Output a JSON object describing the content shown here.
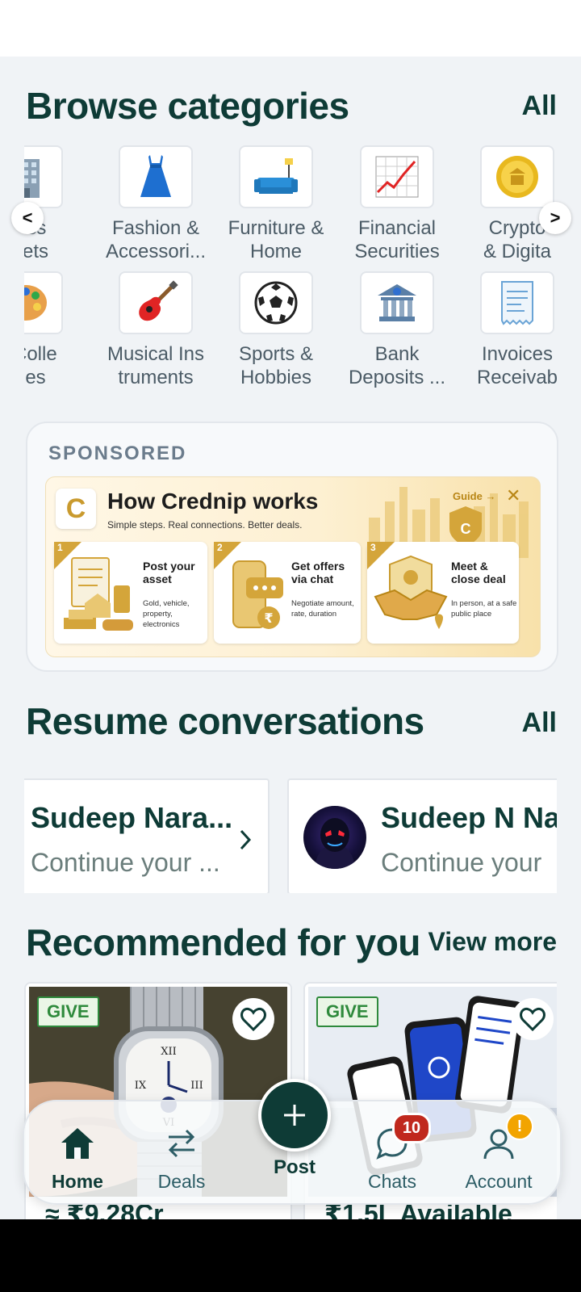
{
  "browse": {
    "title": "Browse categories",
    "all_label": "All",
    "prev_label": "<",
    "next_label": ">",
    "row1": [
      {
        "icon": "office-building-icon",
        "line1": "ness",
        "line2": "ssets"
      },
      {
        "icon": "dress-icon",
        "line1": "Fashion &",
        "line2": "Accessori..."
      },
      {
        "icon": "sofa-icon",
        "line1": "Furniture &",
        "line2": "Home"
      },
      {
        "icon": "chart-icon",
        "line1": "Financial",
        "line2": "Securities"
      },
      {
        "icon": "coin-icon",
        "line1": "Crypto",
        "line2": "& Digita"
      }
    ],
    "row2": [
      {
        "icon": "palette-icon",
        "line1": "& Colle",
        "line2": "ibles"
      },
      {
        "icon": "guitar-icon",
        "line1": "Musical Ins",
        "line2": "truments"
      },
      {
        "icon": "soccer-ball-icon",
        "line1": "Sports &",
        "line2": "Hobbies"
      },
      {
        "icon": "bank-icon",
        "line1": "Bank",
        "line2": "Deposits ..."
      },
      {
        "icon": "receipt-icon",
        "line1": "Invoices",
        "line2": "Receivab"
      }
    ]
  },
  "sponsored": {
    "label": "SPONSORED",
    "banner": {
      "logo": "C",
      "title": "How Crednip works",
      "subtitle": "Simple steps. Real connections. Better deals.",
      "guide": "Guide →",
      "close": "✕",
      "steps": [
        {
          "num": "1",
          "title1": "Post your",
          "title2": "asset",
          "desc1": "Gold, vehicle,",
          "desc2": "property,",
          "desc3": "electronics"
        },
        {
          "num": "2",
          "title1": "Get offers",
          "title2": "via chat",
          "desc1": "Negotiate amount,",
          "desc2": "rate, duration",
          "desc3": ""
        },
        {
          "num": "3",
          "title1": "Meet &",
          "title2": "close deal",
          "desc1": "In person, at a safe",
          "desc2": "public place",
          "desc3": ""
        }
      ]
    }
  },
  "conversations": {
    "title": "Resume conversations",
    "all_label": "All",
    "items": [
      {
        "name": "Sudeep Nara...",
        "message": "Continue your ..."
      },
      {
        "name": "Sudeep N Na",
        "message": "Continue your"
      }
    ]
  },
  "recommended": {
    "title": "Recommended for you",
    "view_more": "View more",
    "items": [
      {
        "badge": "GIVE",
        "price": "≈ ₹9.28Cr"
      },
      {
        "badge": "GIVE",
        "price": "₹1.5L Available"
      }
    ]
  },
  "bottom_nav": {
    "home": "Home",
    "deals": "Deals",
    "post": "Post",
    "chats": "Chats",
    "account": "Account",
    "chats_badge": "10",
    "account_badge": "!"
  },
  "colors": {
    "brand": "#0e3b36",
    "give_green": "#2e8a3c",
    "badge_red": "#c0281d",
    "warning": "#f2a400",
    "gold": "#d4a53a"
  }
}
